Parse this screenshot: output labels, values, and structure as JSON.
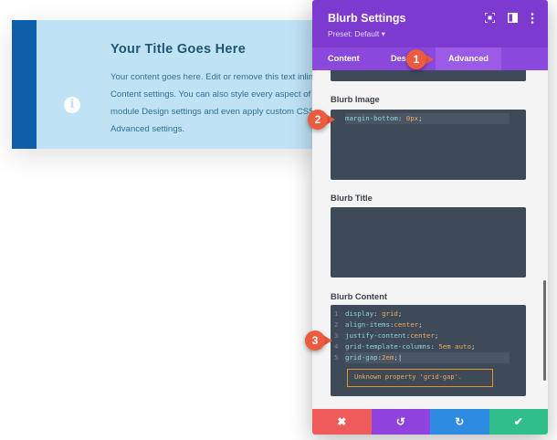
{
  "preview": {
    "title": "Your Title Goes Here",
    "body_lines": [
      "Your content goes here. Edit or remove this text inlin",
      "Content settings. You can also style every aspect of th",
      "module Design settings and even apply custom CSS t",
      "Advanced settings."
    ],
    "info_glyph": "i",
    "icon": "info-circle-icon",
    "colors": {
      "background": "#bfe2f5",
      "accent_bar": "#0f5eaa",
      "title": "#1f5573",
      "text": "#2f7096"
    }
  },
  "panel": {
    "title": "Blurb Settings",
    "preset": "Preset: Default ▾",
    "header_icons": [
      "fullscreen-icon",
      "sidebar-toggle-icon",
      "more-options-icon"
    ],
    "tabs": [
      {
        "label": "Content",
        "active": false
      },
      {
        "label": "Des",
        "active": false
      },
      {
        "label": "Advanced",
        "active": true
      }
    ],
    "colors": {
      "header": "#7d3ad1",
      "tabs": "#8b48dc",
      "code_bg": "#3e4a58"
    }
  },
  "sections": [
    {
      "label": "Blurb Image",
      "lines": [
        {
          "num": "",
          "property": "margin-bottom",
          "value": "0px"
        }
      ]
    },
    {
      "label": "Blurb Title",
      "lines": []
    },
    {
      "label": "Blurb Content",
      "lines": [
        {
          "num": "1",
          "property": "display",
          "value": "grid"
        },
        {
          "num": "2",
          "property": "align-items",
          "value": "center"
        },
        {
          "num": "3",
          "property": "justify-content",
          "value": "center"
        },
        {
          "num": "4",
          "property": "grid-template-columns",
          "value": "5em auto"
        },
        {
          "num": "5",
          "property": "grid-gap",
          "value": "2em"
        }
      ],
      "error": "Unknown property 'grid-gap'."
    }
  ],
  "footer": {
    "buttons": [
      {
        "name": "cancel",
        "glyph": "✖",
        "color": "#ef5a5a"
      },
      {
        "name": "undo",
        "glyph": "↺",
        "color": "#8f42de"
      },
      {
        "name": "redo",
        "glyph": "↻",
        "color": "#2e8ce0"
      },
      {
        "name": "save",
        "glyph": "✔",
        "color": "#2fbf8a"
      }
    ]
  },
  "markers": [
    "1",
    "2",
    "3"
  ]
}
